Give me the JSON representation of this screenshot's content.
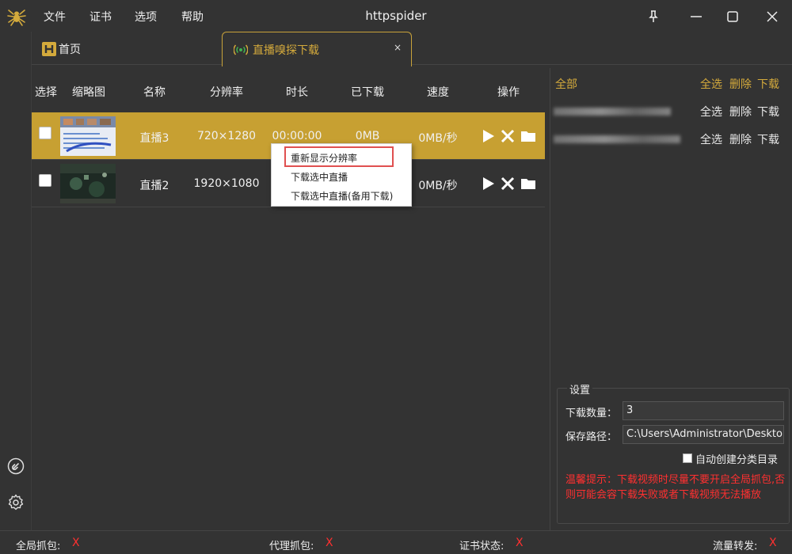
{
  "app": {
    "title": "httpspider",
    "menu": [
      "文件",
      "证书",
      "选项",
      "帮助"
    ]
  },
  "tabs": {
    "home_label": "首页",
    "live_label": "直播嗅探下载",
    "close_glyph": "×"
  },
  "table": {
    "headers": [
      "选择",
      "缩略图",
      "名称",
      "分辨率",
      "时长",
      "已下载",
      "速度",
      "操作"
    ],
    "rows": [
      {
        "name": "直播3",
        "resolution": "720×1280",
        "duration": "00:00:00",
        "downloaded": "0MB",
        "speed": "0MB/秒",
        "selected": true
      },
      {
        "name": "直播2",
        "resolution": "1920×1080",
        "duration": "",
        "downloaded": "",
        "speed": "0MB/秒",
        "selected": false
      }
    ]
  },
  "context_menu": {
    "items": [
      "重新显示分辨率",
      "下载选中直播",
      "下载选中直播(备用下载)"
    ]
  },
  "right_panel": {
    "all_label": "全部",
    "select_all": "全选",
    "delete": "删除",
    "download": "下载"
  },
  "settings": {
    "title": "设置",
    "count_label": "下载数量：",
    "count_value": "3",
    "path_label": "保存路径：",
    "path_value": "C:\\Users\\Administrator\\Desktop\\h",
    "auto_dir_label": "自动创建分类目录",
    "warning": "温馨提示：下载视频时尽量不要开启全局抓包,否则可能会容下载失败或者下载视频无法播放"
  },
  "status": {
    "global_capture": "全局抓包:",
    "proxy_capture": "代理抓包:",
    "cert_status": "证书状态:",
    "traffic_forward": "流量转发:",
    "off_mark": "X"
  },
  "colors": {
    "accent": "#c7a032",
    "accent_text": "#d4aa3c",
    "background": "#333333",
    "alert": "#ff3030"
  }
}
